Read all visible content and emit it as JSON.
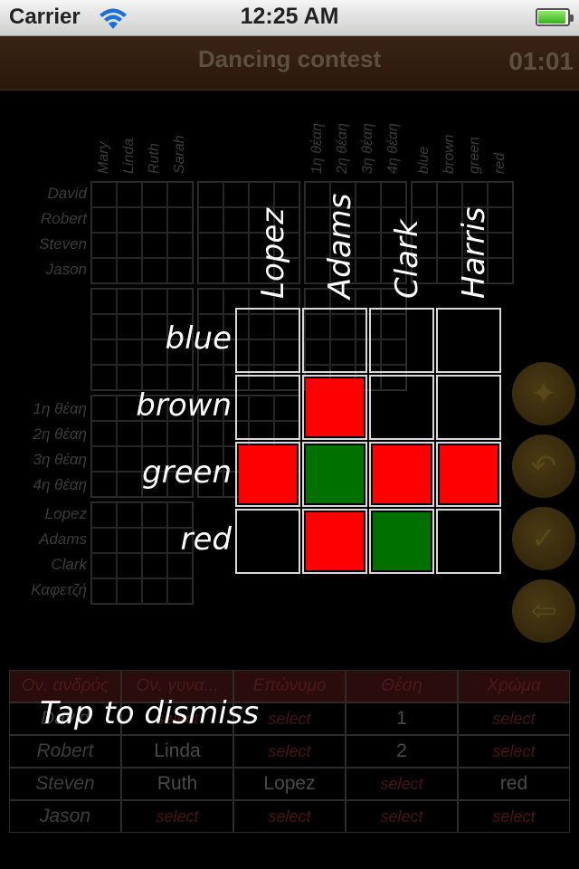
{
  "status_bar": {
    "carrier": "Carrier",
    "time": "12:25 AM",
    "battery_level": 0.95
  },
  "title_bar": {
    "title": "Dancing contest",
    "timer": "01:01"
  },
  "background_grid": {
    "women": [
      "Mary",
      "Linda",
      "Ruth",
      "Sarah"
    ],
    "positions": [
      "1η θέαη",
      "2η θέαη",
      "3η θέαη",
      "4η θέαη"
    ],
    "colors": [
      "blue",
      "brown",
      "green",
      "red"
    ],
    "men": [
      "David",
      "Robert",
      "Steven",
      "Jason"
    ],
    "position_rows": [
      "1η θέαη",
      "2η θέαη",
      "3η θέαη",
      "4η θέαη"
    ],
    "surname_rows": [
      "Lopez",
      "Adams",
      "Clark",
      "Καφετζή"
    ]
  },
  "side_buttons": [
    {
      "name": "hint-icon",
      "glyph": "✦"
    },
    {
      "name": "undo-icon",
      "glyph": "↶"
    },
    {
      "name": "check-icon",
      "glyph": "✓"
    },
    {
      "name": "back-icon",
      "glyph": "⇦"
    }
  ],
  "summary_table": {
    "headers": [
      "Ον. ανδρός",
      "Ον. γυνα...",
      "Επώνυμο",
      "Θέση",
      "Χρώμα"
    ],
    "rows": [
      [
        "David",
        "select",
        "select",
        "1",
        "select"
      ],
      [
        "Robert",
        "Linda",
        "select",
        "2",
        "select"
      ],
      [
        "Steven",
        "Ruth",
        "Lopez",
        "select",
        "red"
      ],
      [
        "Jason",
        "select",
        "select",
        "select",
        "select"
      ]
    ]
  },
  "zoom_grid": {
    "columns": [
      "Lopez",
      "Adams",
      "Clark",
      "Harris"
    ],
    "rows": [
      "blue",
      "brown",
      "green",
      "red"
    ],
    "cells": [
      [
        "empty",
        "empty",
        "empty",
        "empty"
      ],
      [
        "empty",
        "red",
        "empty",
        "empty"
      ],
      [
        "red",
        "green",
        "red",
        "red"
      ],
      [
        "empty",
        "red",
        "green",
        "empty"
      ]
    ]
  },
  "dismiss_text": "Tap to dismiss"
}
